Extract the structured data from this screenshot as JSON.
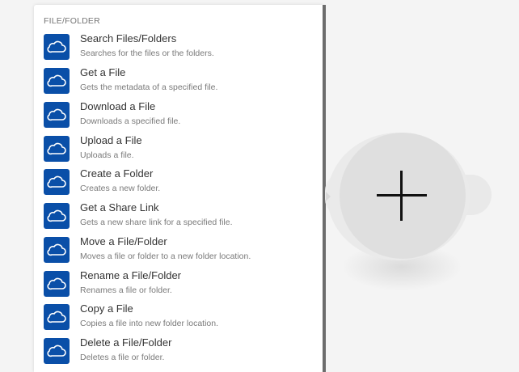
{
  "menu": {
    "section_header": "FILE/FOLDER",
    "items": [
      {
        "title": "Search Files/Folders",
        "description": "Searches for the files or the folders."
      },
      {
        "title": "Get a File",
        "description": "Gets the metadata of a specified file."
      },
      {
        "title": "Download a File",
        "description": "Downloads a specified file."
      },
      {
        "title": "Upload a File",
        "description": "Uploads a file."
      },
      {
        "title": "Create a Folder",
        "description": "Creates a new folder."
      },
      {
        "title": "Get a Share Link",
        "description": "Gets a new share link for a specified file."
      },
      {
        "title": "Move a File/Folder",
        "description": "Moves a file or folder to a new folder location."
      },
      {
        "title": "Rename a File/Folder",
        "description": "Renames a file or folder."
      },
      {
        "title": "Copy a File",
        "description": "Copies a file into new folder location."
      },
      {
        "title": "Delete a File/Folder",
        "description": "Deletes a file or folder."
      }
    ]
  },
  "icons": {
    "item_icon": "onedrive-cloud-icon",
    "add_icon": "plus-icon"
  },
  "colors": {
    "icon_background": "#0a4fa8",
    "module_background": "#dfdfdf"
  }
}
